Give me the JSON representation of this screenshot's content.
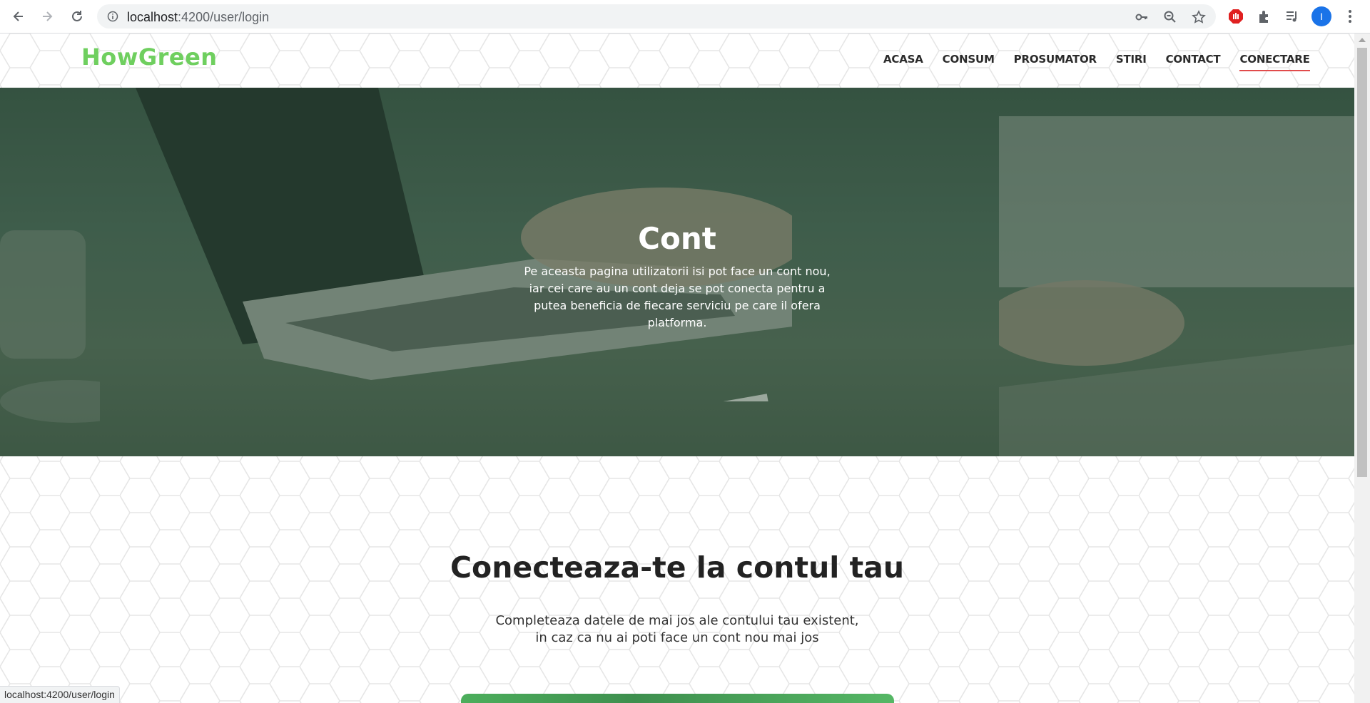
{
  "browser": {
    "url_host": "localhost",
    "url_path": ":4200/user/login",
    "avatar_letter": "I",
    "status_url": "localhost:4200/user/login"
  },
  "header": {
    "logo": "HowGreen",
    "menu": [
      {
        "label": "ACASA"
      },
      {
        "label": "CONSUM"
      },
      {
        "label": "PROSUMATOR"
      },
      {
        "label": "STIRI"
      },
      {
        "label": "CONTACT"
      },
      {
        "label": "CONECTARE",
        "active": true
      }
    ],
    "accent_color": "#e14b4b",
    "logo_color": "#6fcf5f"
  },
  "hero": {
    "title": "Cont",
    "description": "Pe aceasta pagina utilizatorii isi pot face un cont nou, iar cei care au un cont deja se pot conecta pentru a putea beneficia de fiecare serviciu pe care il ofera platforma."
  },
  "login_section": {
    "title": "Conecteaza-te la contul tau",
    "subtitle_line1": "Completeaza datele de mai jos ale contului tau existent,",
    "subtitle_line2": "in caz ca nu ai poti face un cont nou mai jos"
  }
}
